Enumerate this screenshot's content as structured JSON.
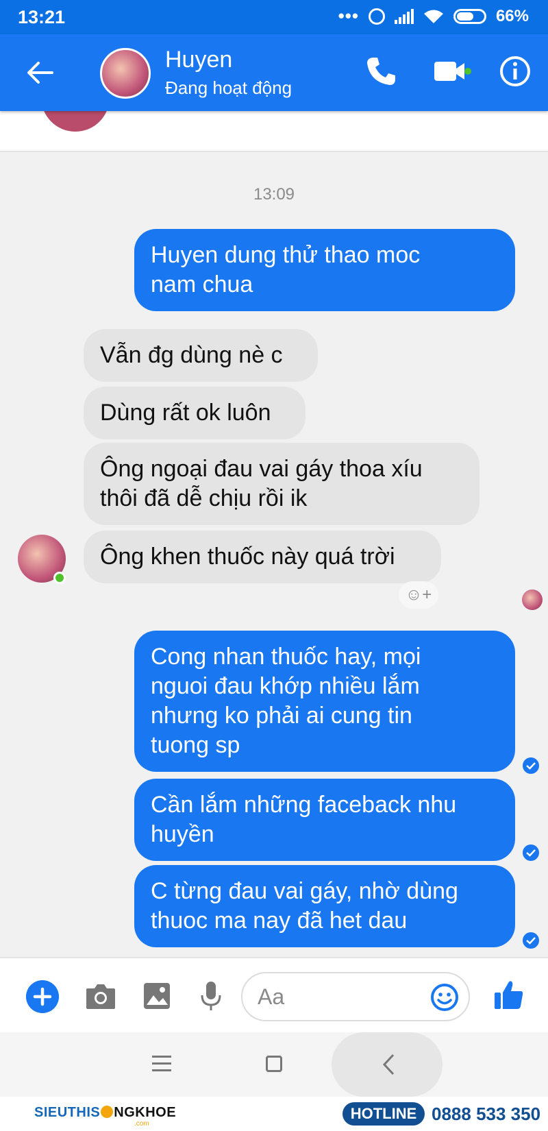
{
  "status_bar": {
    "time": "13:21",
    "dots": "•••",
    "battery": "66%"
  },
  "header": {
    "contact_name": "Huyen",
    "contact_status": "Đang hoạt động"
  },
  "conversation": {
    "timestamp": "13:09",
    "messages": [
      {
        "from": "me",
        "text": "Huyen dung thử thao moc\nnam chua"
      },
      {
        "from": "contact",
        "text": "Vẫn đg dùng nè c"
      },
      {
        "from": "contact",
        "text": "Dùng rất ok luôn"
      },
      {
        "from": "contact",
        "text": "Ông ngoại đau vai gáy thoa xíu\nthôi đã dễ chịu rồi ik"
      },
      {
        "from": "contact",
        "text": "Ông khen thuốc này quá trời"
      },
      {
        "from": "me",
        "text": "Cong nhan thuốc hay, mọi\nnguoi đau khớp nhiều lắm\nnhưng ko phải ai cung tin\ntuong sp"
      },
      {
        "from": "me",
        "text": "Cần lắm những faceback nhu\nhuyền"
      },
      {
        "from": "me",
        "text": "C từng đau vai gáy, nhờ dùng\nthuoc ma nay đã het dau"
      }
    ],
    "react_button": "☺+"
  },
  "composer": {
    "placeholder": "Aa"
  },
  "footer": {
    "brand_part1": "SIEUTHIS",
    "brand_part2": "NGKHOE",
    "brand_sub": ".com",
    "hotline_label": "HOTLINE",
    "hotline_number": "0888 533 350"
  },
  "colors": {
    "messenger_blue": "#1a77f2",
    "incoming_bubble": "#e4e4e4",
    "online_green": "#4fc22b"
  },
  "icons": [
    "back-arrow-icon",
    "phone-icon",
    "video-camera-icon",
    "info-icon",
    "plus-icon",
    "camera-icon",
    "image-icon",
    "microphone-icon",
    "emoji-icon",
    "thumbs-up-icon",
    "read-receipt-check-icon"
  ]
}
